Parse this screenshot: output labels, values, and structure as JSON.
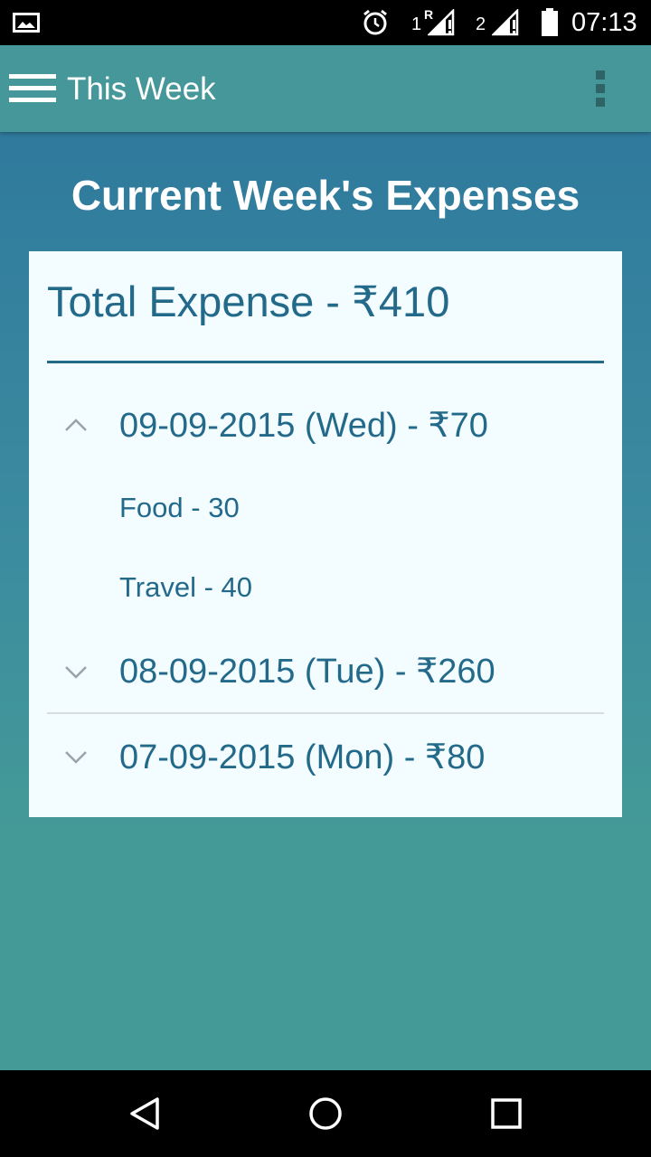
{
  "status_bar": {
    "time": "07:13",
    "sim1_label": "1",
    "sim1_roaming": "R",
    "sim2_label": "2",
    "icons": [
      "gallery-icon",
      "alarm-icon",
      "signal-icon",
      "signal-icon",
      "battery-icon"
    ]
  },
  "app_bar": {
    "title": "This Week",
    "menu_icon": "hamburger-menu-icon",
    "overflow_icon": "more-vert-icon"
  },
  "page": {
    "heading": "Current Week's Expenses"
  },
  "card": {
    "total": "Total Expense - ₹410",
    "days": [
      {
        "label": "09-09-2015 (Wed) - ₹70",
        "expanded": true,
        "items": [
          "Food - 30",
          "Travel - 40"
        ]
      },
      {
        "label": "08-09-2015 (Tue) - ₹260",
        "expanded": false,
        "items": []
      },
      {
        "label": "07-09-2015 (Mon) - ₹80",
        "expanded": false,
        "items": []
      }
    ]
  },
  "nav_bar": {
    "icons": [
      "back-icon",
      "home-icon",
      "recents-icon"
    ]
  },
  "colors": {
    "app_bar": "#46979a",
    "content_top": "#2f7a9d",
    "content_bottom": "#449a97",
    "card_bg": "#f3fcff",
    "text_accent": "#236a8a"
  }
}
